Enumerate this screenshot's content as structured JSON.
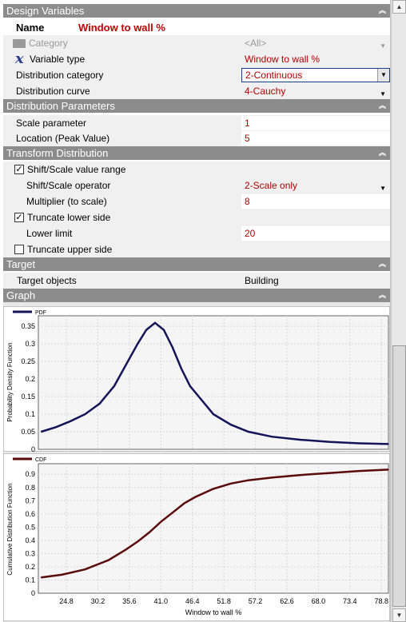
{
  "sections": {
    "design_variables": "Design Variables",
    "distribution_parameters": "Distribution Parameters",
    "transform_distribution": "Transform Distribution",
    "target": "Target",
    "graph": "Graph"
  },
  "name": {
    "label": "Name",
    "value": "Window to wall %"
  },
  "category": {
    "label": "Category",
    "value": "<All>"
  },
  "variable_type": {
    "label": "Variable type",
    "value": "Window to wall %"
  },
  "distribution_category": {
    "label": "Distribution category",
    "value": "2-Continuous"
  },
  "distribution_curve": {
    "label": "Distribution curve",
    "value": "4-Cauchy"
  },
  "scale_parameter": {
    "label": "Scale parameter",
    "value": "1"
  },
  "location": {
    "label": "Location (Peak Value)",
    "value": "5"
  },
  "shift_scale_range": {
    "label": "Shift/Scale value range",
    "checked": true
  },
  "shift_scale_operator": {
    "label": "Shift/Scale operator",
    "value": "2-Scale only"
  },
  "multiplier": {
    "label": "Multiplier (to scale)",
    "value": "8"
  },
  "truncate_lower": {
    "label": "Truncate lower side",
    "checked": true
  },
  "lower_limit": {
    "label": "Lower limit",
    "value": "20"
  },
  "truncate_upper": {
    "label": "Truncate upper side",
    "checked": false
  },
  "target_objects": {
    "label": "Target objects",
    "value": "Building"
  },
  "icons": {
    "collapse": "double-chevron-icon",
    "dropdown": "dropdown-arrow-icon",
    "folder": "folder-icon",
    "variable": "x-variable-icon"
  },
  "colors": {
    "section": "#8c8c8c",
    "value_text": "#b40000",
    "pdf": "#14145a",
    "cdf": "#5a0a0a"
  },
  "chart_data": [
    {
      "type": "line",
      "legend": "PDF",
      "ylabel": "Probability Density Function",
      "xlabel": "",
      "xlim": [
        20,
        80
      ],
      "ylim": [
        0,
        0.38
      ],
      "xticks": [
        24.8,
        30.2,
        35.6,
        41.0,
        46.4,
        51.8,
        57.2,
        62.6,
        68.0,
        73.4,
        78.8
      ],
      "yticks": [
        "0",
        "0.05",
        "0.1",
        "0.15",
        "0.2",
        "0.25",
        "0.3",
        "0.35"
      ],
      "x": [
        20.5,
        23,
        25.5,
        28,
        30.5,
        33,
        35,
        37,
        38.5,
        40,
        41.5,
        43,
        44.5,
        46,
        48,
        50,
        53,
        56,
        60,
        65,
        70,
        75,
        80
      ],
      "y": [
        0.05,
        0.063,
        0.08,
        0.1,
        0.13,
        0.18,
        0.24,
        0.3,
        0.34,
        0.36,
        0.34,
        0.29,
        0.23,
        0.18,
        0.14,
        0.1,
        0.07,
        0.05,
        0.036,
        0.027,
        0.021,
        0.017,
        0.015
      ]
    },
    {
      "type": "line",
      "legend": "CDF",
      "ylabel": "Cumulative Distribution Function",
      "xlabel": "Window to wall %",
      "xlim": [
        20,
        80
      ],
      "ylim": [
        0,
        0.98
      ],
      "xticks": [
        24.8,
        30.2,
        35.6,
        41.0,
        46.4,
        51.8,
        57.2,
        62.6,
        68.0,
        73.4,
        78.8
      ],
      "yticks": [
        "0",
        "0.1",
        "0.2",
        "0.3",
        "0.4",
        "0.5",
        "0.6",
        "0.7",
        "0.8",
        "0.9"
      ],
      "x": [
        20.5,
        24,
        28,
        32,
        35,
        37,
        39,
        41,
        43,
        45,
        47,
        50,
        53,
        56,
        60,
        65,
        70,
        75,
        80
      ],
      "y": [
        0.12,
        0.14,
        0.18,
        0.25,
        0.33,
        0.39,
        0.46,
        0.54,
        0.61,
        0.68,
        0.73,
        0.79,
        0.83,
        0.855,
        0.875,
        0.895,
        0.91,
        0.925,
        0.935
      ]
    }
  ]
}
